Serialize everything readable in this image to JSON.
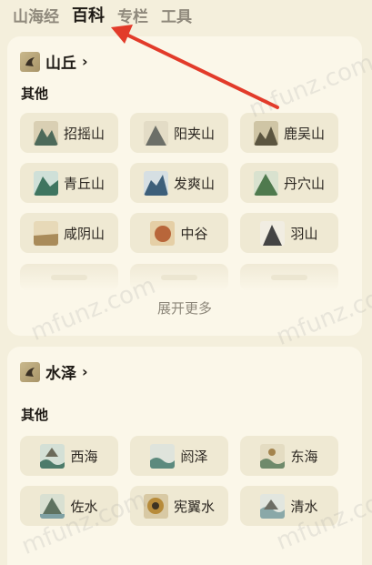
{
  "tabs": [
    {
      "label": "山海经",
      "active": false
    },
    {
      "label": "百科",
      "active": true
    },
    {
      "label": "专栏",
      "active": false
    },
    {
      "label": "工具",
      "active": false
    }
  ],
  "sections": [
    {
      "title": "山丘",
      "subtitle": "其他",
      "items": [
        "招摇山",
        "阳夹山",
        "鹿吴山",
        "青丘山",
        "发爽山",
        "丹穴山",
        "咸阴山",
        "中谷",
        "羽山"
      ],
      "more_label": "展开更多"
    },
    {
      "title": "水泽",
      "subtitle": "其他",
      "items": [
        "西海",
        "阏泽",
        "东海",
        "佐水",
        "宪翼水",
        "清水"
      ]
    }
  ],
  "watermark": "mfunz.com",
  "colors": {
    "background": "#f4efdc",
    "card": "#fbf7e9",
    "chip": "#efe9d3",
    "arrow": "#e23b2a"
  }
}
